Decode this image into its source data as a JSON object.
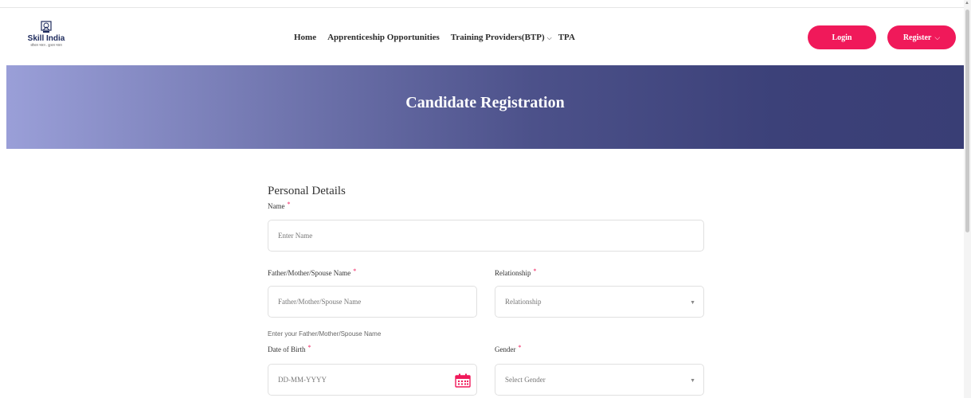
{
  "logo": {
    "name": "Skill India",
    "tagline": "कौशल भारत - कुशल भारत",
    "icon": "skill-india-emblem"
  },
  "nav": {
    "items": [
      {
        "label": "Home",
        "has_dropdown": false
      },
      {
        "label": "Apprenticeship Opportunities",
        "has_dropdown": false
      },
      {
        "label": "Training Providers(BTP)",
        "has_dropdown": true
      },
      {
        "label": "TPA",
        "has_dropdown": false
      }
    ],
    "login_label": "Login",
    "register_label": "Register",
    "chevron": "⌵"
  },
  "banner": {
    "title": "Candidate Registration"
  },
  "form": {
    "section_title": "Personal Details",
    "required_mark": "*",
    "name": {
      "label": "Name",
      "placeholder": "Enter Name"
    },
    "guardian": {
      "label": "Father/Mother/Spouse Name",
      "placeholder": "Father/Mother/Spouse Name",
      "helper": "Enter your Father/Mother/Spouse Name"
    },
    "relationship": {
      "label": "Relationship",
      "placeholder": "Relationship"
    },
    "dob": {
      "label": "Date of Birth",
      "placeholder": "DD-MM-YYYY",
      "icon": "calendar-icon"
    },
    "gender": {
      "label": "Gender",
      "placeholder": "Select Gender"
    },
    "select_caret": "▼"
  },
  "colors": {
    "accent": "#f0195a",
    "banner_dark": "#393e75",
    "banner_light": "#9a9fd8"
  }
}
